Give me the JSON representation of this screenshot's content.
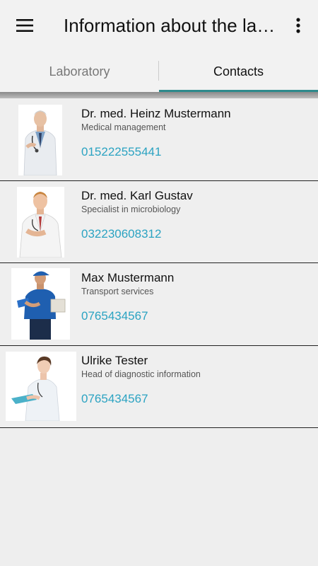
{
  "appbar": {
    "title": "Information about the lab…",
    "menu_icon": "hamburger-menu-icon",
    "more_icon": "more-vertical-icon"
  },
  "tabs": [
    {
      "label": "Laboratory",
      "active": false
    },
    {
      "label": "Contacts",
      "active": true
    }
  ],
  "colors": {
    "accent": "#2e8a8c",
    "phone": "#2ba3c2"
  },
  "contacts": [
    {
      "name": "Dr. med. Heinz Mustermann",
      "role": "Medical management",
      "phone": "015222555441",
      "photo": "doctor-senior-stethoscope"
    },
    {
      "name": "Dr. med. Karl Gustav",
      "role": "Specialist in microbiology",
      "phone": "032230608312",
      "photo": "doctor-smiling-white-coat"
    },
    {
      "name": "Max Mustermann",
      "role": "Transport services",
      "phone": "0765434567",
      "photo": "courier-blue-uniform-package"
    },
    {
      "name": "Ulrike Tester",
      "role": "Head of diagnostic information",
      "phone": "0765434567",
      "photo": "female-doctor-clipboard"
    }
  ]
}
